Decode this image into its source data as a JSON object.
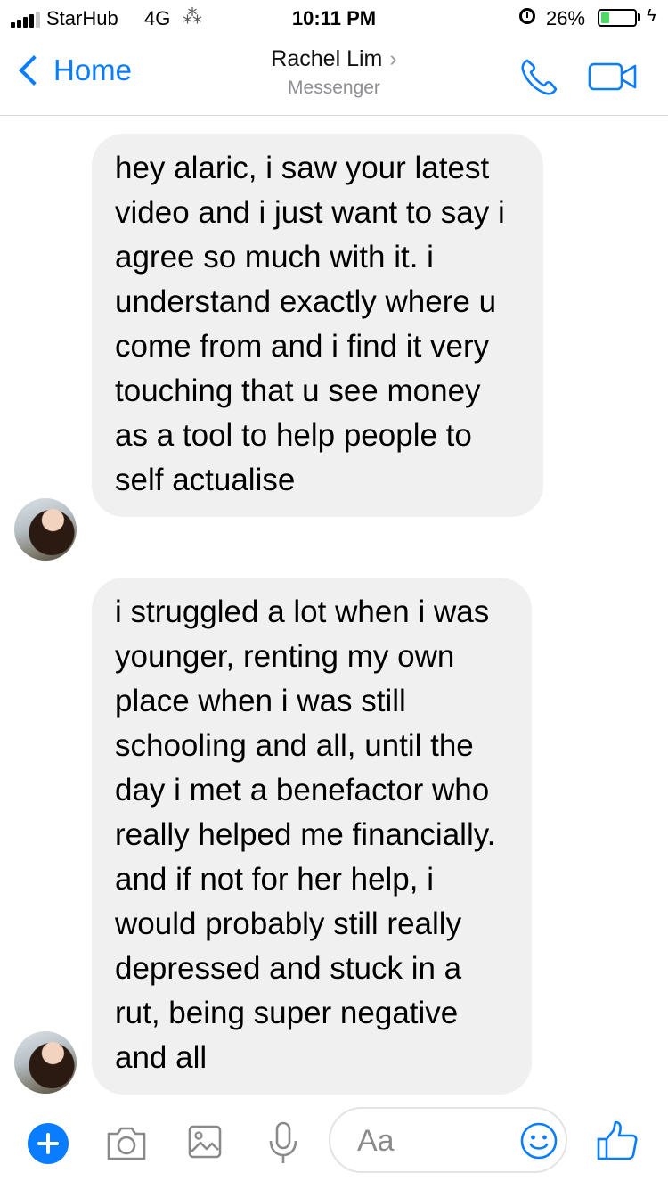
{
  "status_bar": {
    "carrier": "StarHub",
    "network": "4G",
    "activity_glyph": "⁂",
    "time": "10:11 PM",
    "battery_percent_text": "26%",
    "battery_level": 0.26,
    "charging_glyph": "ϟ"
  },
  "nav": {
    "back_label": "Home",
    "contact_name": "Rachel Lim",
    "chevron": "›",
    "subtitle": "Messenger",
    "icons": [
      "chevron-left-icon",
      "phone-icon",
      "video-camera-icon"
    ],
    "accent_color": "#0a7cff"
  },
  "messages": [
    {
      "sender": "Rachel Lim",
      "text": "hey alaric, i saw your latest video and i just want to say i agree so much with it. i understand exactly where u come from and i find it very touching that u see money as a tool to help people to self actualise"
    },
    {
      "sender": "Rachel Lim",
      "text": "i struggled a lot when i was younger, renting my own place when i was still schooling and all, until the day i met a benefactor who really helped me financially. and if not for her help, i would probably still really depressed and stuck in a rut, being super negative and all"
    }
  ],
  "composer": {
    "placeholder": "Aa",
    "icons": [
      "plus-icon",
      "camera-icon",
      "gallery-icon",
      "microphone-icon",
      "emoji-icon",
      "thumbs-up-icon"
    ]
  },
  "colors": {
    "bubble_bg": "#f0f0f0",
    "battery_green": "#4cd964",
    "secondary_text": "#8e8e93"
  }
}
